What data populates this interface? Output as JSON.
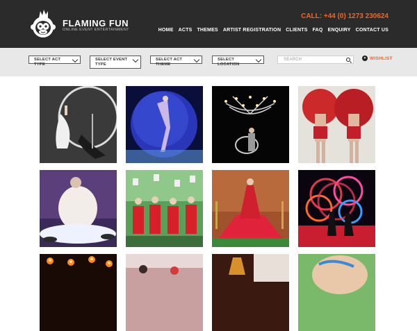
{
  "brand": {
    "name": "FLAMING FUN",
    "tagline": "ONLINE EVENT ENTERTAINMENT",
    "logo": "monkey-flame-logo"
  },
  "header": {
    "phone": "CALL: +44 (0) 1273 230624"
  },
  "nav": [
    "HOME",
    "ACTS",
    "THEMES",
    "ARTIST REGISTRATION",
    "CLIENTS",
    "FAQ",
    "ENQUIRY",
    "CONTACT US"
  ],
  "filters": {
    "act_type": "SELECT ACT TYPE",
    "event_type": "SELECT EVENT TYPE",
    "act_theme": "SELECT ACT THEME",
    "location": "SELECT LOCATION"
  },
  "search": {
    "placeholder": "SEARCH",
    "icon": "search-icon"
  },
  "wishlist": {
    "label": "WISHLIST",
    "icon": "heart-icon"
  },
  "colors": {
    "header_bg": "#2b2b2b",
    "accent": "#f26522",
    "filter_bg": "#e8e8e8"
  },
  "acts": [
    {
      "name": "aerial-hoop-dancer"
    },
    {
      "name": "zorb-ball-performer"
    },
    {
      "name": "chandelier-aerialist"
    },
    {
      "name": "showgirls-red-feathers"
    },
    {
      "name": "living-table-performer"
    },
    {
      "name": "red-dress-models"
    },
    {
      "name": "red-carpet-dress"
    },
    {
      "name": "led-hula-hoops"
    },
    {
      "name": "fire-performers"
    },
    {
      "name": "party-performers"
    },
    {
      "name": "flame-dancer"
    },
    {
      "name": "face-painting"
    }
  ]
}
